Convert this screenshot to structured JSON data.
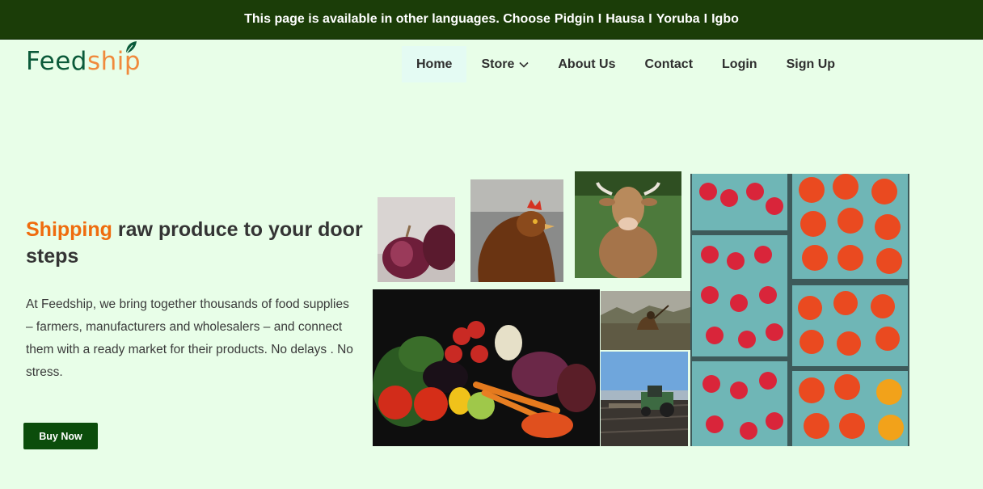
{
  "topbar": {
    "message": "This page is available in other languages. Choose",
    "languages": [
      "Pidgin",
      "Hausa",
      "Yoruba",
      "Igbo"
    ],
    "separator": "I"
  },
  "logo": {
    "part1": "Feed",
    "part2": "ship"
  },
  "nav": {
    "items": [
      {
        "label": "Home",
        "active": true
      },
      {
        "label": "Store",
        "has_dropdown": true
      },
      {
        "label": "About Us"
      },
      {
        "label": "Contact"
      },
      {
        "label": "Login"
      },
      {
        "label": "Sign Up"
      }
    ]
  },
  "hero": {
    "title_accent": "Shipping",
    "title_rest": "raw produce to your door steps",
    "body": "At Feedship, we bring together thousands of food supplies – farmers, manufacturers and wholesalers – and connect them with a ready market for their products. No delays . No stress.",
    "button_label": "Buy Now"
  },
  "photos": [
    "red onions",
    "hen",
    "cow",
    "strawberries and tomatoes",
    "vegetables",
    "farmer working",
    "tractor in field"
  ],
  "colors": {
    "topbar_bg": "#1b3d08",
    "page_bg": "#e8fee8",
    "accent": "#ef6c0e",
    "button_bg": "#0b4d0b",
    "logo_green": "#0b5a3a",
    "logo_orange": "#f08a3c"
  }
}
